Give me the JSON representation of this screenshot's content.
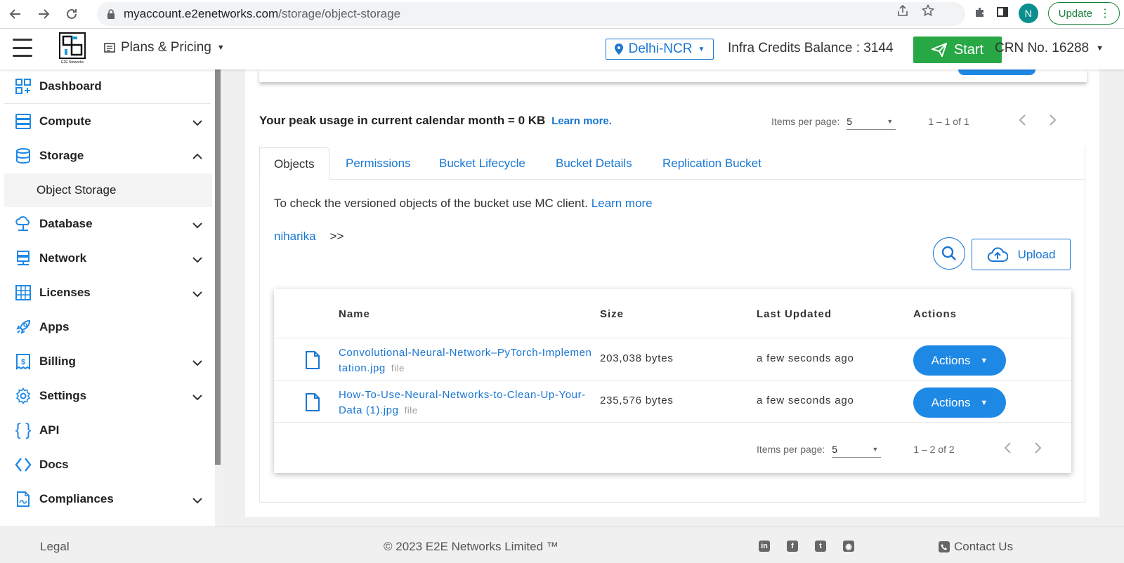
{
  "browser": {
    "url_host": "myaccount.e2enetworks.com",
    "url_path": "/storage/object-storage",
    "avatar_letter": "N",
    "update_label": "Update"
  },
  "header": {
    "plans_label": "Plans & Pricing",
    "region_label": "Delhi-NCR",
    "credits_label": "Infra Credits Balance : 3144",
    "start_label": "Start",
    "crn_label": "CRN No. 16288",
    "logo_text": "E2E Networks"
  },
  "sidebar": {
    "items": [
      {
        "label": "Dashboard",
        "icon": "dashboard-icon"
      },
      {
        "label": "Compute",
        "icon": "server-icon"
      },
      {
        "label": "Storage",
        "icon": "database-icon"
      },
      {
        "label": "Database",
        "icon": "cloud-network-icon"
      },
      {
        "label": "Network",
        "icon": "network-icon"
      },
      {
        "label": "Licenses",
        "icon": "grid-icon"
      },
      {
        "label": "Apps",
        "icon": "rocket-icon"
      },
      {
        "label": "Billing",
        "icon": "billing-icon"
      },
      {
        "label": "Settings",
        "icon": "gear-icon"
      },
      {
        "label": "API",
        "icon": "braces-icon"
      },
      {
        "label": "Docs",
        "icon": "code-icon"
      },
      {
        "label": "Compliances",
        "icon": "document-icon"
      }
    ],
    "sub_item": "Object Storage"
  },
  "main": {
    "peak_text": "Your peak usage in current calendar month = 0 KB",
    "peak_link": "Learn more.",
    "top_pager": {
      "label": "Items per page:",
      "value": "5",
      "range": "1 – 1 of 1"
    },
    "tabs": [
      "Objects",
      "Permissions",
      "Bucket Lifecycle",
      "Bucket Details",
      "Replication Bucket"
    ],
    "hint_text": "To check the versioned objects of the bucket use MC client.",
    "hint_link": "Learn more",
    "breadcrumb": {
      "bucket": "niharika",
      "sep": ">>"
    },
    "upload_label": "Upload",
    "table": {
      "headers": [
        "Name",
        "Size",
        "Last Updated",
        "Actions"
      ],
      "rows": [
        {
          "name": "Convolutional-Neural-Network–PyTorch-Implementation.jpg",
          "kind": "file",
          "size": "203,038 bytes",
          "updated": "a few seconds ago",
          "action": "Actions"
        },
        {
          "name": "How-To-Use-Neural-Networks-to-Clean-Up-Your-Data (1).jpg",
          "kind": "file",
          "size": "235,576 bytes",
          "updated": "a few seconds ago",
          "action": "Actions"
        }
      ]
    },
    "bottom_pager": {
      "label": "Items per page:",
      "value": "5",
      "range": "1 – 2 of 2"
    }
  },
  "footer": {
    "legal": "Legal",
    "copyright": "© 2023 E2E Networks Limited ™",
    "social": [
      "linkedin-icon",
      "facebook-icon",
      "twitter-icon",
      "rss-icon"
    ],
    "contact": "Contact Us"
  },
  "colors": {
    "accent": "#1976d2",
    "start": "#28a745",
    "action": "#1e88e5"
  }
}
